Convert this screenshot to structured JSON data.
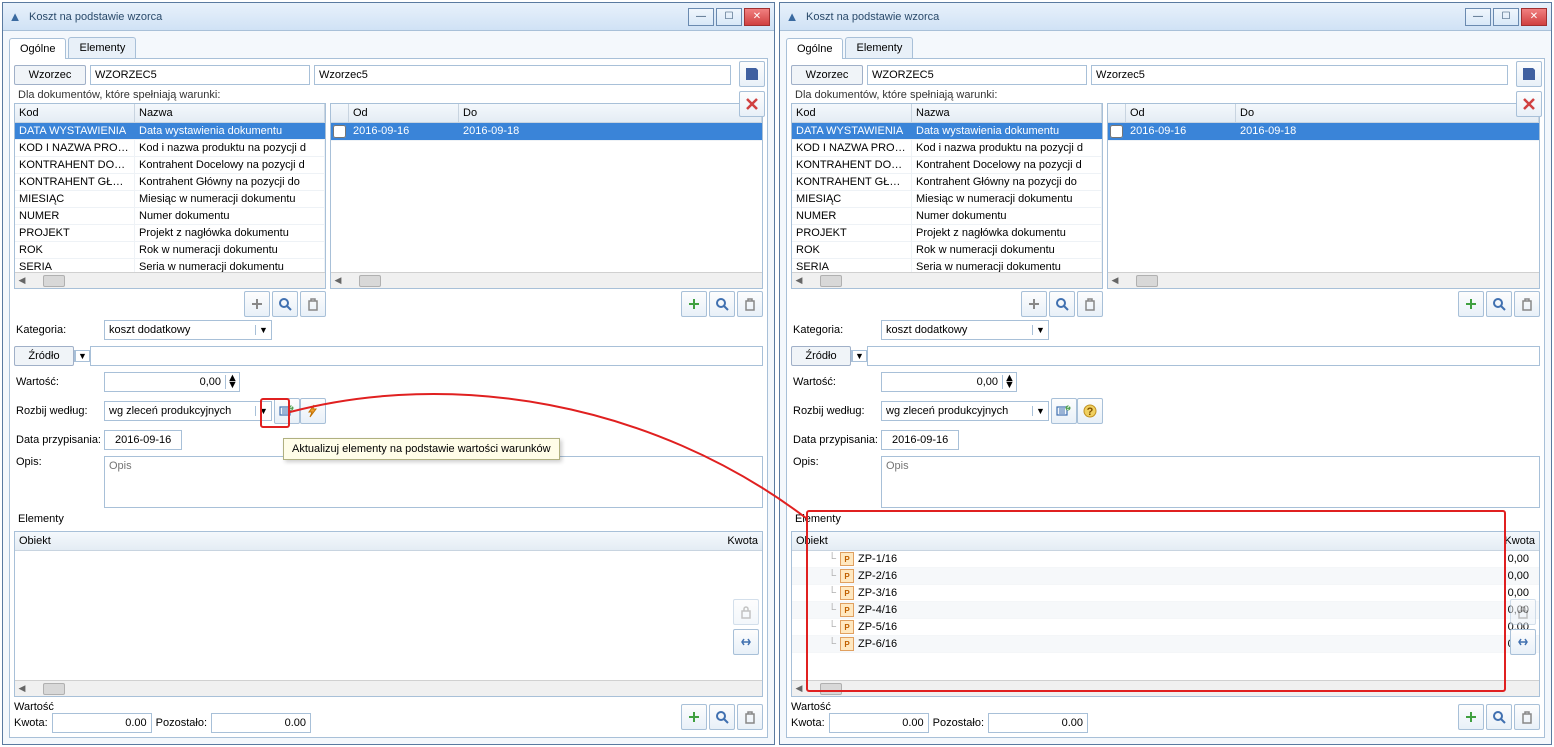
{
  "title": "Koszt na podstawie wzorca",
  "tabs": [
    "Ogólne",
    "Elementy"
  ],
  "wzorzec_label": "Wzorzec",
  "wzorzec_code": "WZORZEC5",
  "wzorzec_name": "Wzorzec5",
  "cond_label": "Dla dokumentów, które spełniają warunki:",
  "cond_headers_left": {
    "kod": "Kod",
    "nazwa": "Nazwa"
  },
  "cond_headers_right": {
    "od": "Od",
    "do": "Do"
  },
  "cond_rows": [
    {
      "kod": "DATA WYSTAWIENIA",
      "nazwa": "Data wystawienia dokumentu"
    },
    {
      "kod": "KOD I NAZWA PRODUKT",
      "nazwa": "Kod i nazwa produktu na pozycji d"
    },
    {
      "kod": "KONTRAHENT DOCELOW",
      "nazwa": "Kontrahent Docelowy na pozycji d"
    },
    {
      "kod": "KONTRAHENT GŁÓWNY",
      "nazwa": "Kontrahent Główny na pozycji do"
    },
    {
      "kod": "MIESIĄC",
      "nazwa": "Miesiąc w numeracji dokumentu"
    },
    {
      "kod": "NUMER",
      "nazwa": "Numer dokumentu"
    },
    {
      "kod": "PROJEKT",
      "nazwa": "Projekt z nagłówka dokumentu"
    },
    {
      "kod": "ROK",
      "nazwa": "Rok w numeracji dokumentu"
    },
    {
      "kod": "SERIA",
      "nazwa": "Seria w numeracji dokumentu"
    }
  ],
  "date_range": {
    "od": "2016-09-16",
    "do": "2016-09-18"
  },
  "form": {
    "kategoria_label": "Kategoria:",
    "kategoria_value": "koszt dodatkowy",
    "zrodlo_label": "Źródło",
    "wartosc_label": "Wartość:",
    "wartosc_value": "0,00",
    "rozbij_label": "Rozbij według:",
    "rozbij_value": "wg zleceń produkcyjnych",
    "data_label": "Data przypisania:",
    "data_value": "2016-09-16",
    "opis_label": "Opis:",
    "opis_placeholder": "Opis"
  },
  "tooltip": "Aktualizuj elementy na podstawie wartości warunków",
  "elements_label": "Elementy",
  "elements_headers": {
    "obiekt": "Obiekt",
    "kwota": "Kwota"
  },
  "elements_rows_left": [],
  "elements_rows_right": [
    {
      "name": "ZP-1/16",
      "kwota": "0,00"
    },
    {
      "name": "ZP-2/16",
      "kwota": "0,00"
    },
    {
      "name": "ZP-3/16",
      "kwota": "0,00"
    },
    {
      "name": "ZP-4/16",
      "kwota": "0,00"
    },
    {
      "name": "ZP-5/16",
      "kwota": "0,00"
    },
    {
      "name": "ZP-6/16",
      "kwota": "0,00"
    }
  ],
  "bottom": {
    "wartosc_label": "Wartość",
    "kwota_label": "Kwota:",
    "kwota_value": "0.00",
    "pozostalo_label": "Pozostało:",
    "pozostalo_value": "0.00"
  }
}
